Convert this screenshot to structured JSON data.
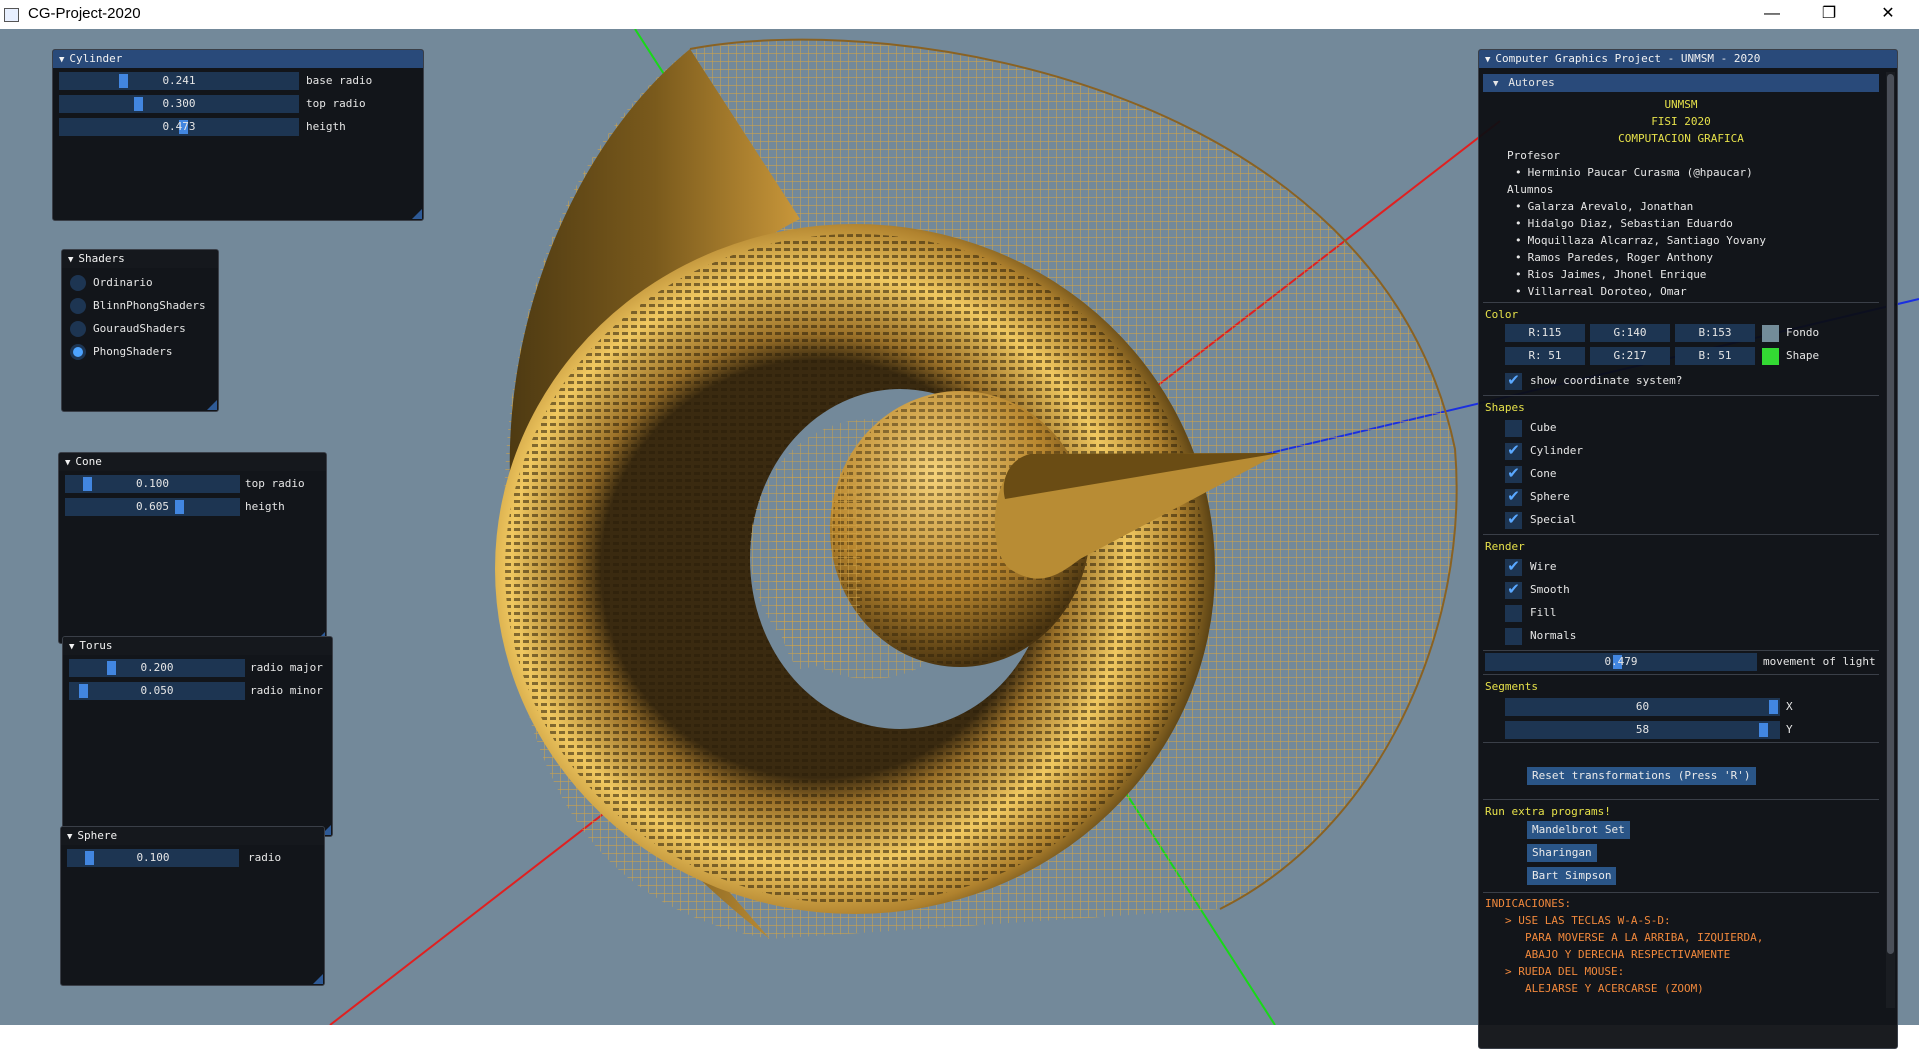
{
  "window": {
    "title": "CG-Project-2020",
    "minimize_glyph": "—",
    "restore_glyph": "❐",
    "close_glyph": "✕",
    "icon": "app-window-icon"
  },
  "colors": {
    "viewport_bg": "#73899a",
    "shape_gold": "#c9973a",
    "axis_x": "#e02020",
    "axis_y": "#18d818",
    "axis_z": "#1a2fe0",
    "panel_header": "#294a7a",
    "accent": "#4286e0"
  },
  "cylinder": {
    "title": "Cylinder",
    "sliders": [
      {
        "label": "base radio",
        "value": "0.241",
        "fraction": 0.27
      },
      {
        "label": "top radio",
        "value": "0.300",
        "fraction": 0.34
      },
      {
        "label": "heigth",
        "value": "0.473",
        "fraction": 0.52
      }
    ]
  },
  "shaders": {
    "title": "Shaders",
    "options": [
      {
        "label": "Ordinario",
        "selected": false
      },
      {
        "label": "BlinnPhongShaders",
        "selected": false
      },
      {
        "label": "GouraudShaders",
        "selected": false
      },
      {
        "label": "PhongShaders",
        "selected": true
      }
    ]
  },
  "cone": {
    "title": "Cone",
    "sliders": [
      {
        "label": "top radio",
        "value": "0.100",
        "fraction": 0.12
      },
      {
        "label": "heigth",
        "value": "0.605",
        "fraction": 0.66
      }
    ]
  },
  "torus": {
    "title": "Torus",
    "sliders": [
      {
        "label": "radio major",
        "value": "0.200",
        "fraction": 0.22
      },
      {
        "label": "radio minor",
        "value": "0.050",
        "fraction": 0.06
      }
    ]
  },
  "sphere": {
    "title": "Sphere",
    "sliders": [
      {
        "label": "radio",
        "value": "0.100",
        "fraction": 0.12
      }
    ]
  },
  "main": {
    "title": "Computer Graphics Project - UNMSM - 2020",
    "authors": {
      "header": "Autores",
      "institution": [
        "UNMSM",
        "FISI 2020",
        "COMPUTACION GRAFICA"
      ],
      "profesor_label": "Profesor",
      "profesor": "Herminio Paucar Curasma (@hpaucar)",
      "alumnos_label": "Alumnos",
      "alumnos": [
        "Galarza Arevalo, Jonathan",
        "Hidalgo Diaz, Sebastian Eduardo",
        "Moquillaza Alcarraz, Santiago Yovany",
        "Ramos Paredes, Roger Anthony",
        "Rios Jaimes, Jhonel Enrique",
        "Villarreal Doroteo, Omar"
      ]
    },
    "color": {
      "header": "Color",
      "fondo": {
        "r": "R:115",
        "g": "G:140",
        "b": "B:153",
        "label": "Fondo",
        "swatch": "#738c99"
      },
      "shape": {
        "r": "R: 51",
        "g": "G:217",
        "b": "B: 51",
        "label": "Shape",
        "swatch": "#33d933"
      },
      "show_coords": {
        "label": "show coordinate system?",
        "checked": true
      }
    },
    "shapes": {
      "header": "Shapes",
      "items": [
        {
          "label": "Cube",
          "checked": false
        },
        {
          "label": "Cylinder",
          "checked": true
        },
        {
          "label": "Cone",
          "checked": true
        },
        {
          "label": "Sphere",
          "checked": true
        },
        {
          "label": "Special",
          "checked": true
        }
      ]
    },
    "render": {
      "header": "Render",
      "items": [
        {
          "label": "Wire",
          "checked": true
        },
        {
          "label": "Smooth",
          "checked": true
        },
        {
          "label": "Fill",
          "checked": false
        },
        {
          "label": "Normals",
          "checked": false
        }
      ],
      "light": {
        "label": "movement of light",
        "value": "0.479",
        "fraction": 0.48
      }
    },
    "segments": {
      "header": "Segments",
      "x": {
        "label": "X",
        "value": "60",
        "fraction": 0.97
      },
      "y": {
        "label": "Y",
        "value": "58",
        "fraction": 0.93
      }
    },
    "reset_label": "Reset transformations (Press 'R')",
    "extra": {
      "header": "Run extra programs!",
      "buttons": [
        "Mandelbrot Set",
        "Sharingan",
        "Bart Simpson"
      ]
    },
    "indicaciones": {
      "header": "INDICACIONES:",
      "lines": [
        "> USE LAS TECLAS W-A-S-D:",
        "PARA MOVERSE A LA ARRIBA, IZQUIERDA,",
        "ABAJO Y DERECHA RESPECTIVAMENTE",
        "> RUEDA DEL MOUSE:",
        "ALEJARSE Y ACERCARSE (ZOOM)"
      ]
    }
  }
}
